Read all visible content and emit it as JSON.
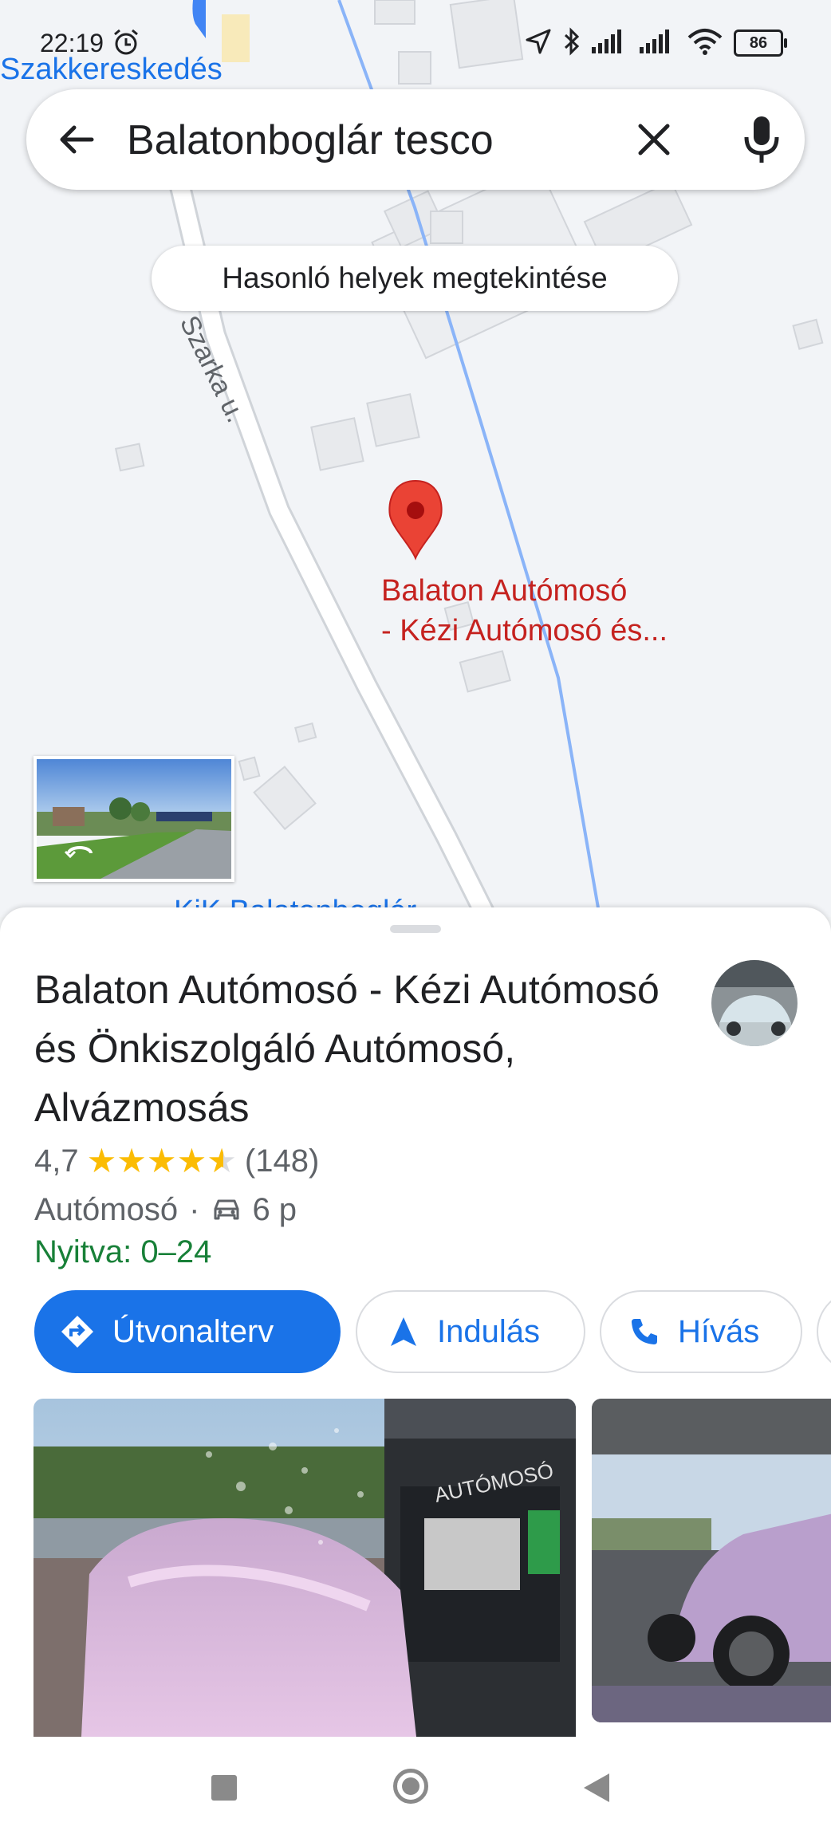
{
  "status_bar": {
    "time": "22:19",
    "battery": "86",
    "icons": [
      "alarm-icon",
      "location-arrow-icon",
      "bluetooth-icon",
      "signal-icon",
      "signal-icon",
      "wifi-icon",
      "battery-icon"
    ]
  },
  "map": {
    "poi_label": "Szakkereskedés",
    "street_label": "Szarka u.",
    "pin_label_line1": "Balaton Autómosó",
    "pin_label_line2": "- Kézi Autómosó és...",
    "partial_label": "KiK Balatonboglár",
    "similar_places_chip": "Hasonló helyek megtekintése"
  },
  "search": {
    "query": "Balatonboglár tesco",
    "back_icon": "arrow-back-icon",
    "clear_icon": "close-icon",
    "mic_icon": "microphone-icon"
  },
  "place": {
    "title": "Balaton Autómosó - Kézi Autómosó és Önkiszolgáló Autómosó, Alvázmosás",
    "rating": "4,7",
    "rating_value": 4.7,
    "review_count": "(148)",
    "category": "Autómosó",
    "separator": "·",
    "drive_time": "6 p",
    "hours": "Nyitva: 0–24"
  },
  "actions": {
    "directions": "Útvonalterv",
    "start": "Indulás",
    "call": "Hívás"
  },
  "colors": {
    "accent": "#1a73e8",
    "pin": "#ea4335",
    "pin_label": "#c5221f",
    "open": "#188038",
    "star": "#fbbc04"
  }
}
